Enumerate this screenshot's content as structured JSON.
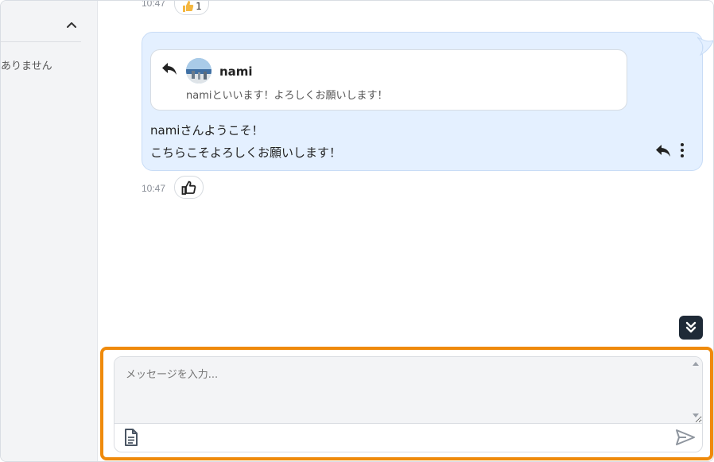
{
  "sidebar": {
    "empty_text": "ありません",
    "collapse_icon": "chevron-up-icon"
  },
  "messages": {
    "previous": {
      "time": "10:47",
      "reaction_count": "1"
    },
    "current": {
      "reply_to": {
        "name": "nami",
        "text": "namiといいます！よろしくお願いします！"
      },
      "lines": [
        "namiさんようこそ！",
        "こちらこそよろしくお願いします！"
      ],
      "time": "10:47",
      "actions": [
        "reply-icon",
        "more-vertical-icon"
      ],
      "reaction_icon": "thumbs-up-icon"
    }
  },
  "scroll_bottom_icon": "double-chevron-down-icon",
  "composer": {
    "placeholder": "メッセージを入力...",
    "attach_icon": "document-icon",
    "send_icon": "send-icon"
  },
  "colors": {
    "bubble_bg": "#e4f0ff",
    "highlight": "#ef8a0b",
    "reaction_emoji": "#f4b740",
    "scroll_btn": "#1f2a37"
  }
}
